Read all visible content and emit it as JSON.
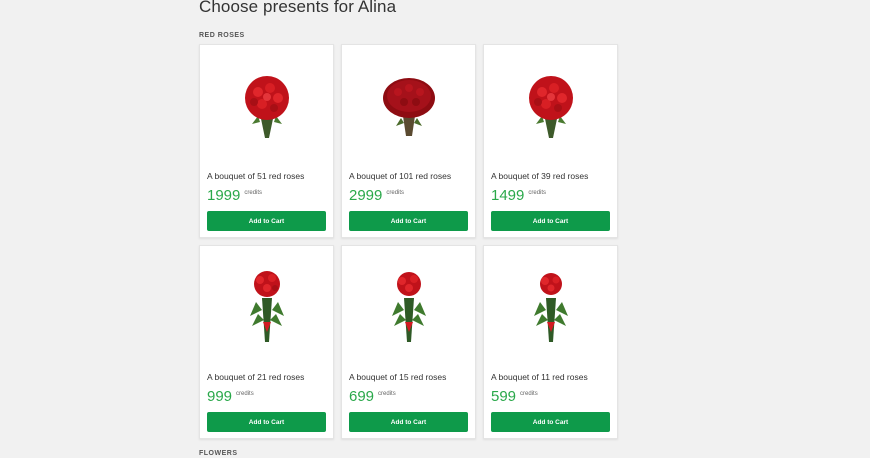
{
  "page": {
    "title": "Choose presents for Alina"
  },
  "sections": [
    {
      "label": "RED ROSES"
    },
    {
      "label": "FLOWERS"
    }
  ],
  "products": [
    {
      "title": "A bouquet of 51 red roses",
      "price": "1999",
      "currency": "credits",
      "button": "Add to Cart",
      "image_icon": "large-round-rose-bouquet-icon"
    },
    {
      "title": "A bouquet of 101 red roses",
      "price": "2999",
      "currency": "credits",
      "button": "Add to Cart",
      "image_icon": "dome-rose-bouquet-icon"
    },
    {
      "title": "A bouquet of 39 red roses",
      "price": "1499",
      "currency": "credits",
      "button": "Add to Cart",
      "image_icon": "large-round-rose-bouquet-icon"
    },
    {
      "title": "A bouquet of 21 red roses",
      "price": "999",
      "currency": "credits",
      "button": "Add to Cart",
      "image_icon": "tall-rose-bouquet-icon"
    },
    {
      "title": "A bouquet of 15 red roses",
      "price": "699",
      "currency": "credits",
      "button": "Add to Cart",
      "image_icon": "tall-rose-bouquet-icon"
    },
    {
      "title": "A bouquet of 11 red roses",
      "price": "599",
      "currency": "credits",
      "button": "Add to Cart",
      "image_icon": "tall-rose-bouquet-icon"
    }
  ],
  "colors": {
    "price": "#2aa84a",
    "button": "#0e9a4a",
    "rose": "#c0121a"
  }
}
